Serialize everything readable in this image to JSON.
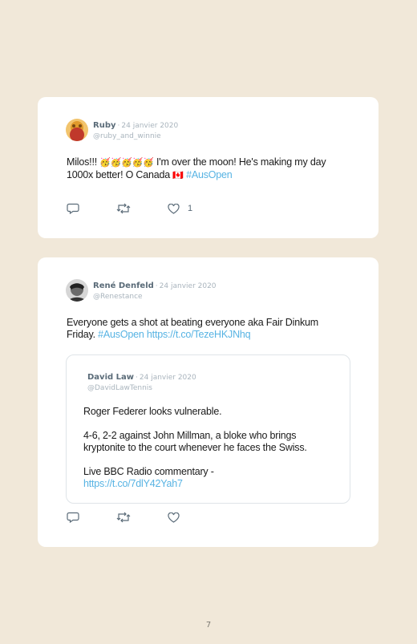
{
  "tweets": [
    {
      "name": "Ruby",
      "date": "24 janvier 2020",
      "handle": "@ruby_and_winnie",
      "text_line1_pre": "Milos!!! ",
      "emoji": "🥳🥳🥳🥳🥳",
      "text_line1_post": " I'm over the moon! He's making my day",
      "text_line2": "1000x better! O Canada ",
      "flag": "🇨🇦",
      "hashtag": " #AusOpen",
      "like_count": "1",
      "icons": [
        "reply-icon",
        "retweet-icon",
        "heart-icon"
      ]
    },
    {
      "name": "René Denfeld",
      "date": "24 janvier 2020",
      "handle": "@Renestance",
      "text_line1": "Everyone gets a shot at beating everyone aka Fair Dinkum",
      "text_line2_pre": "Friday. ",
      "hashtag": "#AusOpen",
      "link": " https://t.co/TezeHKJNhq",
      "quoted": {
        "name": "David Law",
        "date": "24 janvier 2020",
        "handle": "@DavidLawTennis",
        "para1": "Roger Federer looks vulnerable.",
        "para2_line1": "4-6, 2-2 against John Millman, a bloke who brings",
        "para2_line2": "kryptonite to the court whenever he faces the Swiss.",
        "para3_line1": "Live BBC Radio commentary -",
        "para3_link": "https://t.co/7dlY42Yah7"
      }
    }
  ],
  "separator": "·",
  "page_number": "7",
  "colors": {
    "page_background": "#f1e8d9",
    "card": "#ffffff",
    "link": "#57b3e3",
    "name": "#5a6b78",
    "meta": "#a9b4bd"
  }
}
